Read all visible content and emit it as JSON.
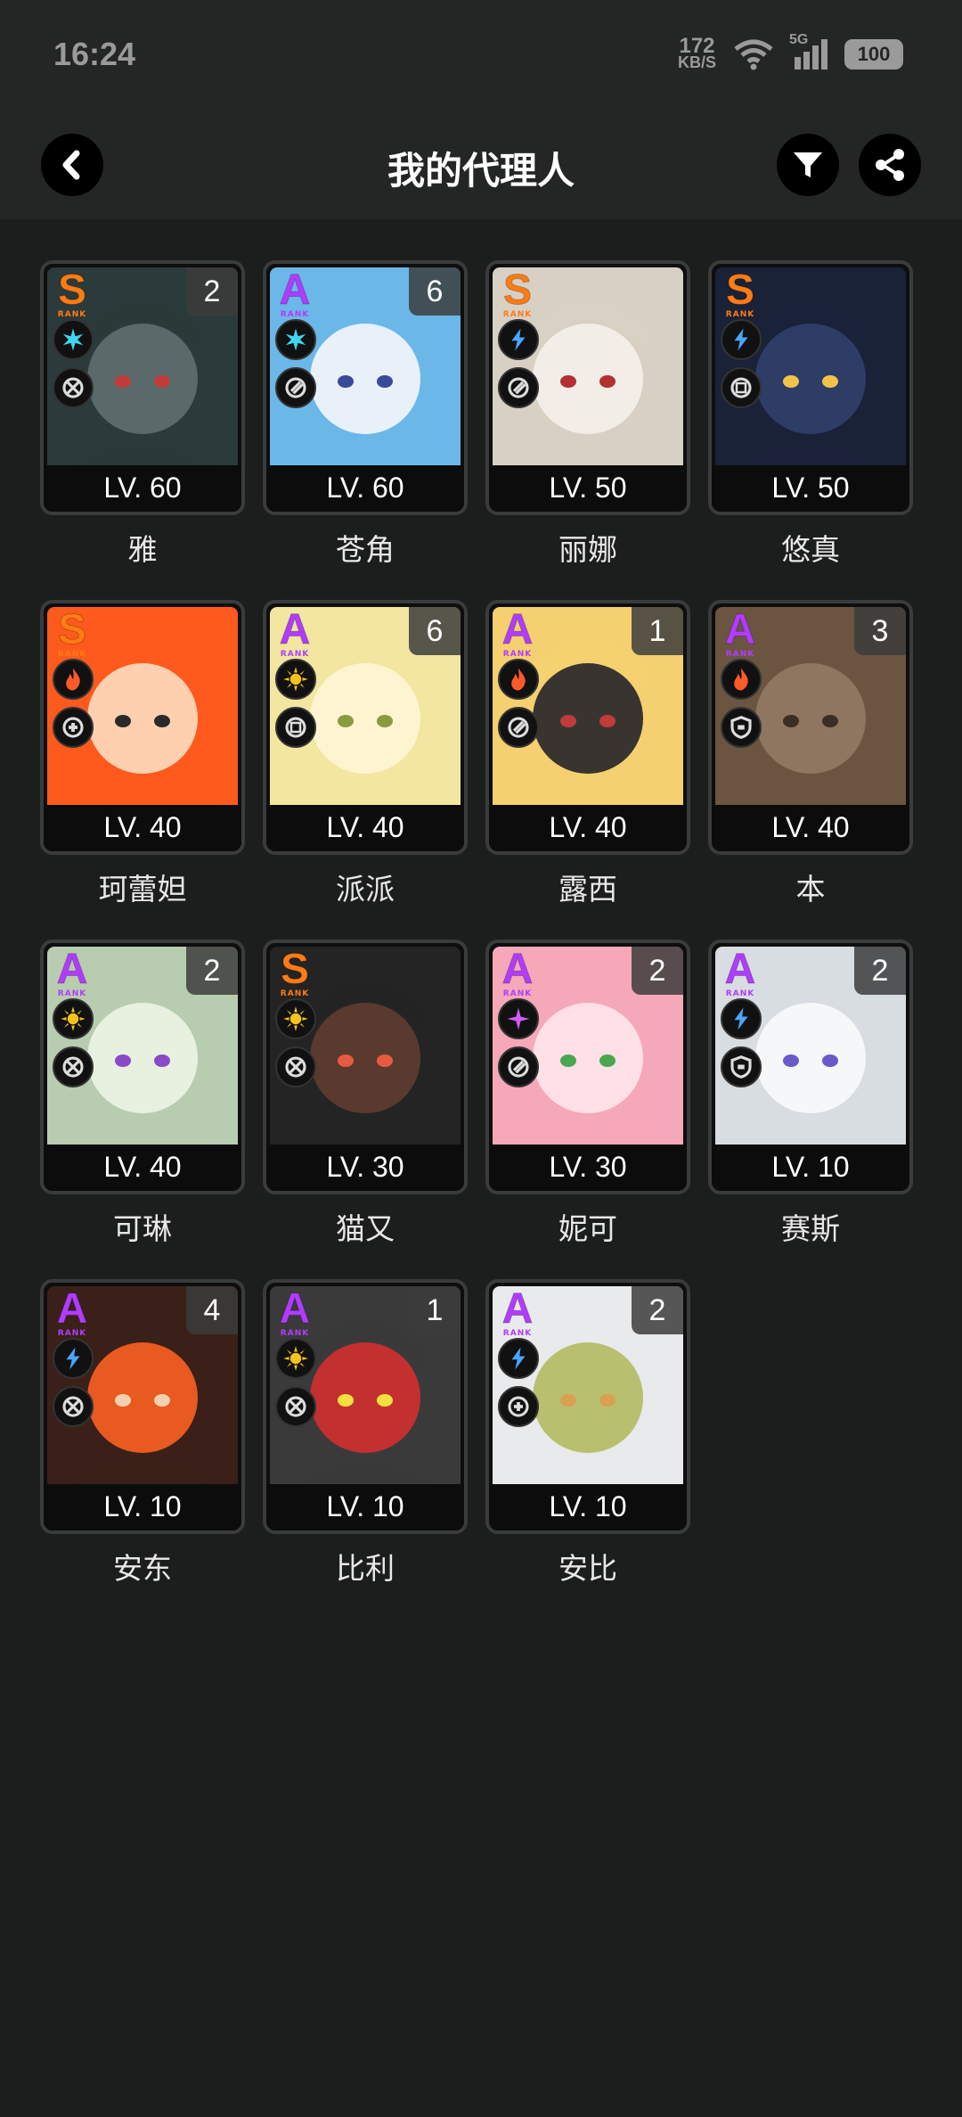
{
  "status": {
    "time": "16:24",
    "netspeed_value": "172",
    "netspeed_unit": "KB/S",
    "network": "5G",
    "battery": "100"
  },
  "header": {
    "title": "我的代理人",
    "back_icon": "chevron-left-icon",
    "filter_icon": "filter-icon",
    "share_icon": "share-icon"
  },
  "rank_sub": "RANK",
  "colors": {
    "rank_S": "#ff7b14",
    "rank_A": "#b13cff",
    "ice": "#3fd6f0",
    "electric": "#4aa6ff",
    "fire": "#ff5a2a",
    "physical": "#f5c21b",
    "ether": "#d35cff"
  },
  "agents": [
    {
      "name": "雅",
      "level": "LV. 60",
      "rank": "S",
      "cinema": "2",
      "attribute": "ice",
      "specialty": "attack"
    },
    {
      "name": "苍角",
      "level": "LV. 60",
      "rank": "A",
      "cinema": "6",
      "attribute": "ice",
      "specialty": "support"
    },
    {
      "name": "丽娜",
      "level": "LV. 50",
      "rank": "S",
      "cinema": "",
      "attribute": "electric",
      "specialty": "support"
    },
    {
      "name": "悠真",
      "level": "LV. 50",
      "rank": "S",
      "cinema": "",
      "attribute": "electric",
      "specialty": "anomaly"
    },
    {
      "name": "珂蕾妲",
      "level": "LV. 40",
      "rank": "S",
      "cinema": "",
      "attribute": "fire",
      "specialty": "stun"
    },
    {
      "name": "派派",
      "level": "LV. 40",
      "rank": "A",
      "cinema": "6",
      "attribute": "physical",
      "specialty": "anomaly"
    },
    {
      "name": "露西",
      "level": "LV. 40",
      "rank": "A",
      "cinema": "1",
      "attribute": "fire",
      "specialty": "support"
    },
    {
      "name": "本",
      "level": "LV. 40",
      "rank": "A",
      "cinema": "3",
      "attribute": "fire",
      "specialty": "defense"
    },
    {
      "name": "可琳",
      "level": "LV. 40",
      "rank": "A",
      "cinema": "2",
      "attribute": "physical",
      "specialty": "attack"
    },
    {
      "name": "猫又",
      "level": "LV. 30",
      "rank": "S",
      "cinema": "",
      "attribute": "physical",
      "specialty": "attack"
    },
    {
      "name": "妮可",
      "level": "LV. 30",
      "rank": "A",
      "cinema": "2",
      "attribute": "ether",
      "specialty": "support"
    },
    {
      "name": "赛斯",
      "level": "LV. 10",
      "rank": "A",
      "cinema": "2",
      "attribute": "electric",
      "specialty": "defense"
    },
    {
      "name": "安东",
      "level": "LV. 10",
      "rank": "A",
      "cinema": "4",
      "attribute": "electric",
      "specialty": "attack"
    },
    {
      "name": "比利",
      "level": "LV. 10",
      "rank": "A",
      "cinema": "1",
      "attribute": "physical",
      "specialty": "attack"
    },
    {
      "name": "安比",
      "level": "LV. 10",
      "rank": "A",
      "cinema": "2",
      "attribute": "electric",
      "specialty": "stun"
    }
  ]
}
